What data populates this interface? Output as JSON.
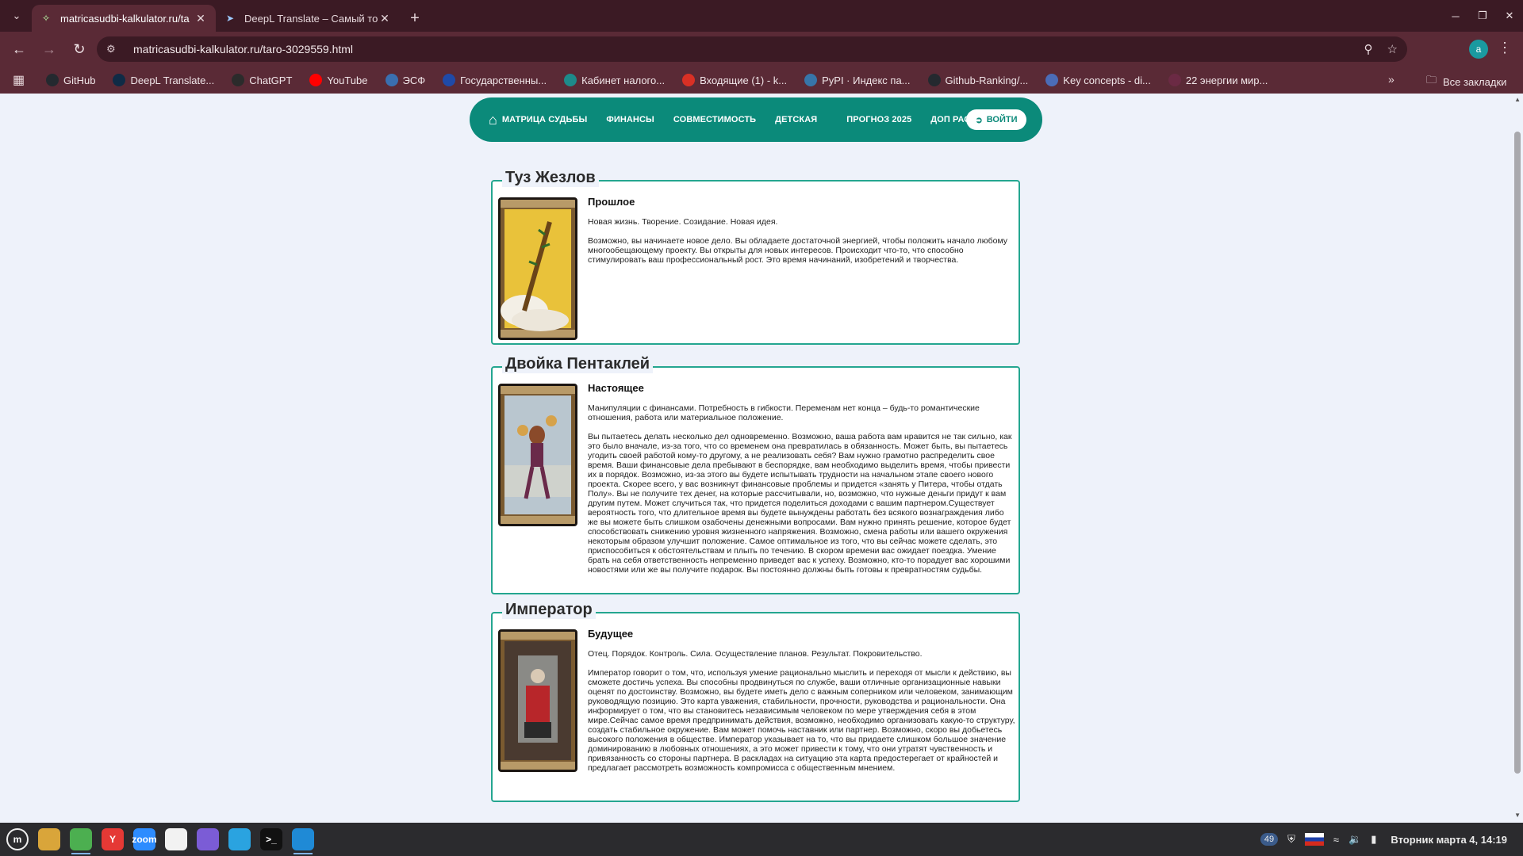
{
  "browser": {
    "tabs": [
      {
        "title": "matricasudbi-kalkulator.ru/ta",
        "active": true
      },
      {
        "title": "DeepL Translate – Самый точ",
        "active": false
      }
    ],
    "url": "matricasudbi-kalkulator.ru/taro-3029559.html",
    "profile_initial": "a",
    "bookmarks": [
      {
        "label": "GitHub",
        "icon": "github-icon",
        "color": "#24292f"
      },
      {
        "label": "DeepL Translate...",
        "icon": "deepl-icon",
        "color": "#0f2b46"
      },
      {
        "label": "ChatGPT",
        "icon": "chatgpt-icon",
        "color": "#2b2b2b"
      },
      {
        "label": "YouTube",
        "icon": "youtube-icon",
        "color": "#ff0000"
      },
      {
        "label": "ЭСФ",
        "icon": "esf-icon",
        "color": "#3a6fb0"
      },
      {
        "label": "Государственны...",
        "icon": "gov-icon",
        "color": "#1f4aa8"
      },
      {
        "label": "Кабинет налого...",
        "icon": "tax-icon",
        "color": "#1d8a8a"
      },
      {
        "label": "Входящие (1) - k...",
        "icon": "gmail-icon",
        "color": "#d93025"
      },
      {
        "label": "PyPI · Индекс па...",
        "icon": "pypi-icon",
        "color": "#3775a9"
      },
      {
        "label": "Github-Ranking/...",
        "icon": "github-icon",
        "color": "#24292f"
      },
      {
        "label": "Key concepts - di...",
        "icon": "docs-icon",
        "color": "#4b6cb7"
      },
      {
        "label": "22 энергии мир...",
        "icon": "energy-icon",
        "color": "#6b2a44"
      }
    ],
    "all_bookmarks": "Все закладки"
  },
  "site_nav": {
    "items": [
      "МАТРИЦА СУДЬБЫ",
      "ФИНАНСЫ",
      "СОВМЕСТИМОСТЬ",
      "ДЕТСКАЯ",
      "ПРОГНОЗ 2025",
      "ДОП РАСЧЕТЫ"
    ],
    "login": "ВОЙТИ",
    "accent": "#0b8a7a"
  },
  "cards": [
    {
      "title": "Туз Жезлов",
      "position": "Прошлое",
      "keywords": "Новая жизнь. Творение. Созидание. Новая идея.",
      "text": "Возможно, вы начинаете новое дело. Вы обладаете достаточной энергией, чтобы положить начало любому многообещающему проекту. Вы открыты для новых интересов. Происходит что-то, что способно стимулировать ваш профессиональный рост. Это время начинаний, изобретений и творчества."
    },
    {
      "title": "Двойка Пентаклей",
      "position": "Настоящее",
      "keywords": "Манипуляции с финансами. Потребность в гибкости. Переменам нет конца – будь-то романтические отношения, работа или материальное положение.",
      "text": "Вы пытаетесь делать несколько дел одновременно. Возможно, ваша работа вам нравится не так сильно, как это было вначале, из-за того, что со временем она превратилась в обязанность. Может быть, вы пытаетесь угодить своей работой кому-то другому, а не реализовать себя? Вам нужно грамотно распределить свое время. Ваши финансовые дела пребывают в беспорядке, вам необходимо выделить время, чтобы привести их в порядок. Возможно, из-за этого вы будете испытывать трудности на начальном этапе своего нового проекта. Скорее всего, у вас возникнут финансовые проблемы и придется «занять у Питера, чтобы отдать Полу». Вы не получите тех денег, на которые рассчитывали, но, возможно, что нужные деньги придут к вам другим путем. Может случиться так, что придется поделиться доходами с вашим партнером.Существует вероятность того, что длительное время вы будете вынуждены работать без всякого вознаграждения либо же вы можете быть слишком озабочены денежными вопросами. Вам нужно принять решение, которое будет способствовать снижению уровня жизненного напряжения. Возможно, смена работы или вашего окружения некоторым образом улучшит положение. Самое оптимальное из того, что вы сейчас можете сделать, это приспособиться к обстоятельствам и плыть по течению. В скором времени вас ожидает поездка. Умение брать на себя ответственность непременно приведет вас к успеху. Возможно, кто-то порадует вас хорошими новостями или же вы получите подарок. Вы постоянно должны быть готовы к превратностям судьбы."
    },
    {
      "title": "Император",
      "position": "Будущее",
      "keywords": "Отец. Порядок. Контроль. Сила. Осуществление планов. Результат. Покровительство.",
      "text": "Император говорит о том, что, используя умение рационально мыслить и переходя от мысли к действию, вы сможете достичь успеха. Вы способны продвинуться по службе, ваши отличные организационные навыки оценят по достоинству. Возможно, вы будете иметь дело с важным соперником или человеком, занимающим руководящую позицию. Это карта уважения, стабильности, прочности, руководства и рациональности. Она информирует о том, что вы становитесь независимым человеком по мере утверждения себя в этом мире.Сейчас самое время предпринимать действия, возможно, необходимо организовать какую-то структуру, создать стабильное окружение. Вам может помочь наставник или партнер. Возможно, скоро вы добьетесь высокого положения в обществе. Император указывает на то, что вы придаете слишком большое значение доминированию в любовных отношениях, а это может привести к тому, что они утратят чувственность и привязанность со стороны партнера. В раскладах на ситуацию эта карта предостерегает от крайностей и предлагает рассмотреть возможность компромисса с общественным мнением."
    }
  ],
  "taskbar": {
    "apps": [
      {
        "name": "files-app-icon",
        "label": "",
        "color": "#d9a53a",
        "running": false
      },
      {
        "name": "chrome-app-icon",
        "label": "",
        "color": "#4caf50",
        "running": true
      },
      {
        "name": "yandex-app-icon",
        "label": "Y",
        "color": "#e53935",
        "running": false
      },
      {
        "name": "zoom-app-icon",
        "label": "zoom",
        "color": "#2d8cff",
        "running": false
      },
      {
        "name": "inkscape-app-icon",
        "label": "",
        "color": "#f2f2f2",
        "running": false
      },
      {
        "name": "obsidian-app-icon",
        "label": "",
        "color": "#7b5cd6",
        "running": false
      },
      {
        "name": "telegram-app-icon",
        "label": "",
        "color": "#2aa3e0",
        "running": false
      },
      {
        "name": "terminal-app-icon",
        "label": ">_",
        "color": "#111111",
        "running": false
      },
      {
        "name": "vscode-app-icon",
        "label": "",
        "color": "#1f8ad6",
        "running": true
      }
    ],
    "tray_badge": "49",
    "clock": "Вторник марта 4, 14:19"
  }
}
